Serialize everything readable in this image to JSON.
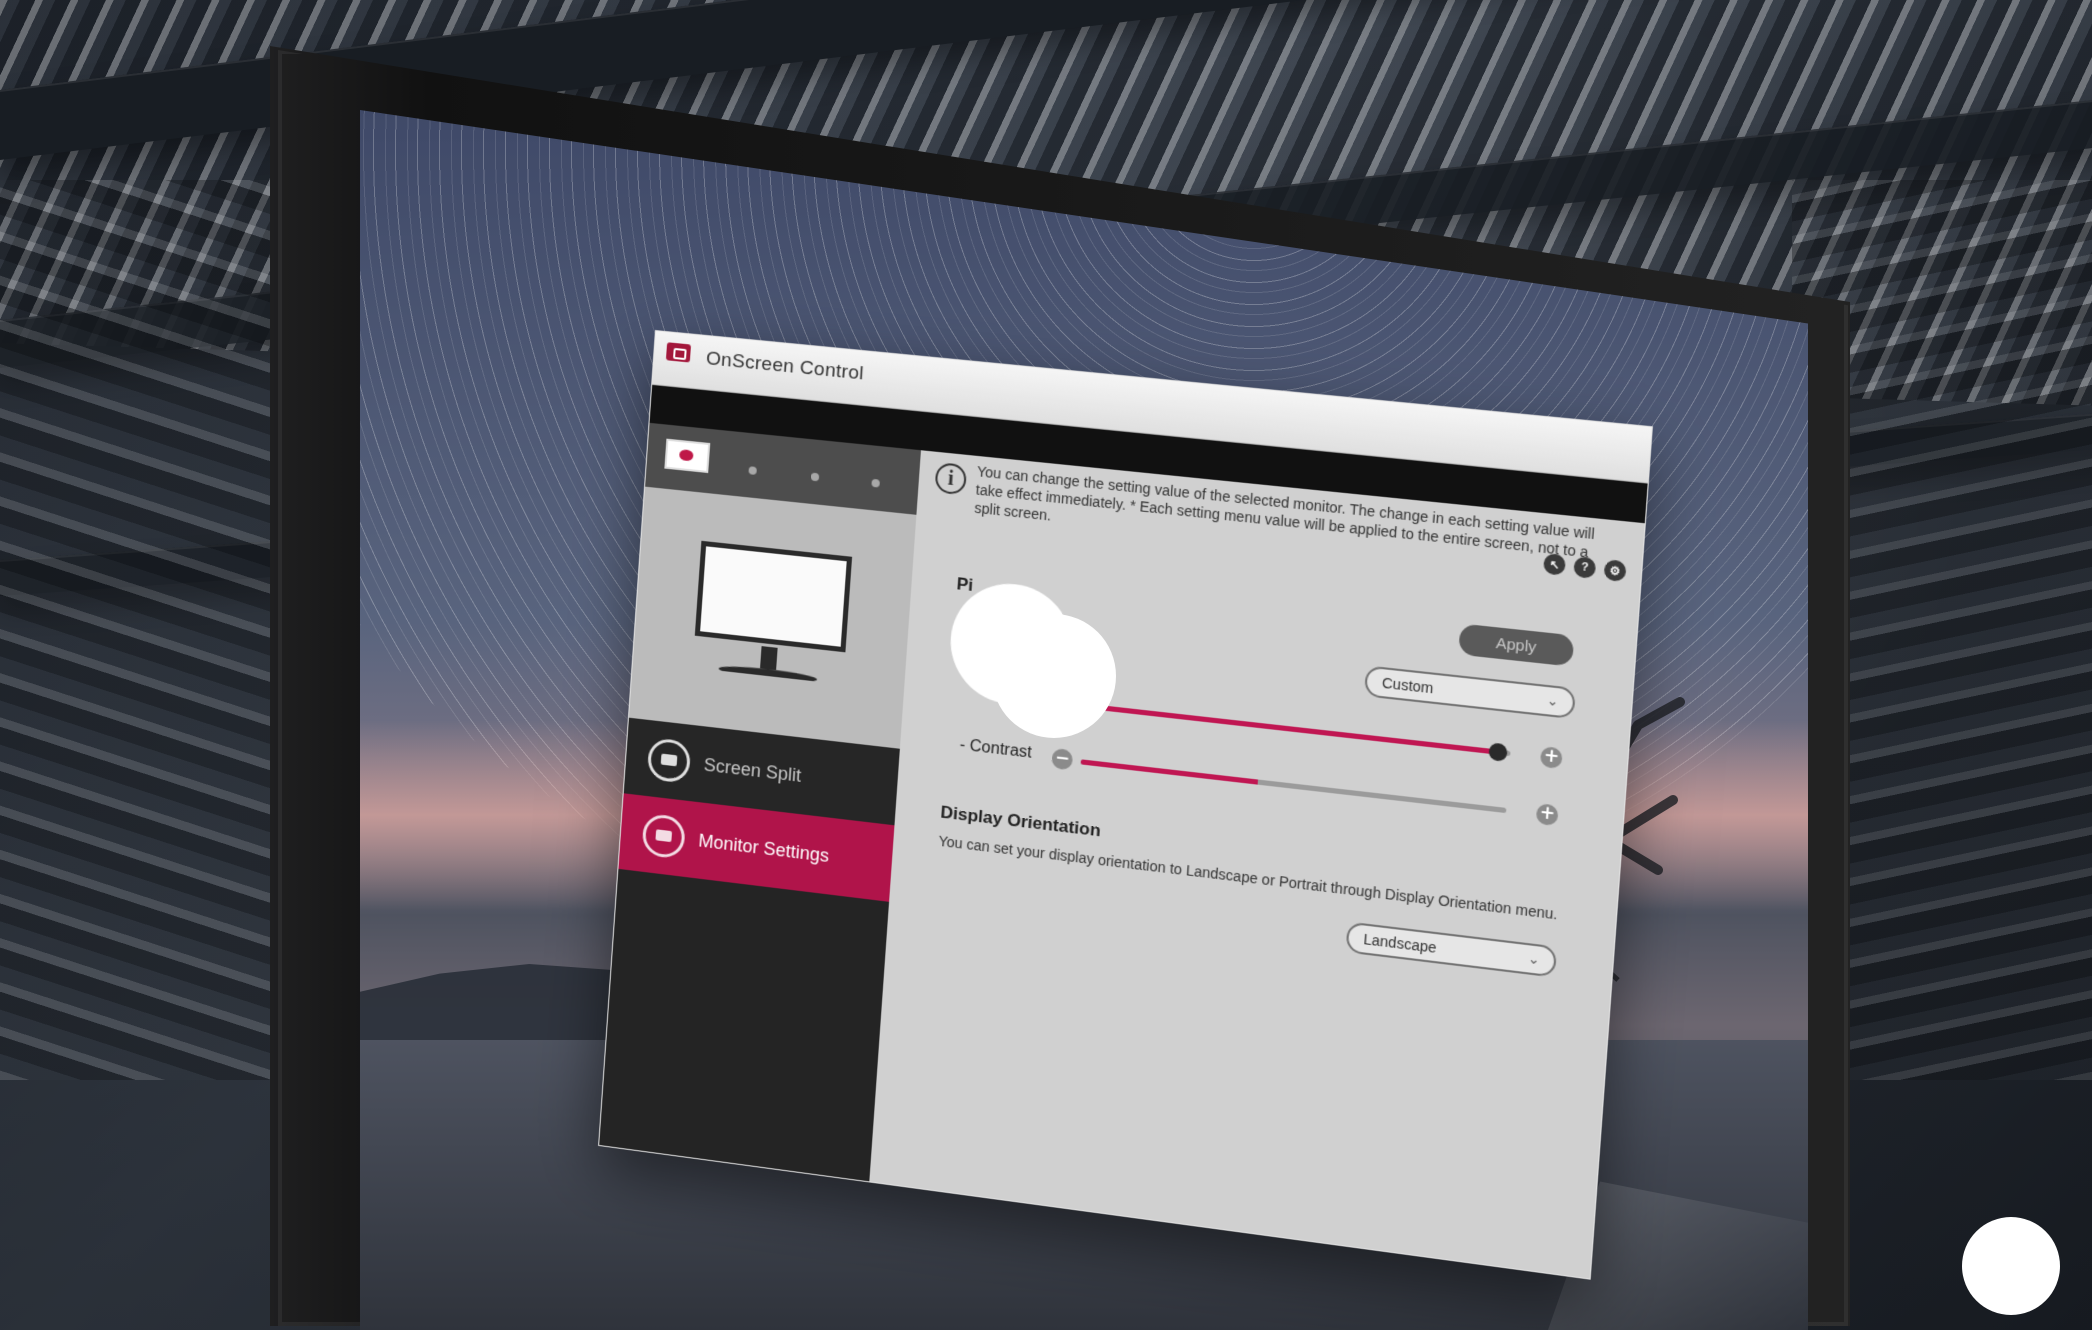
{
  "window": {
    "title": "OnScreen Control"
  },
  "sidebar": {
    "items": [
      {
        "label": "Screen Split",
        "active": false
      },
      {
        "label": "Monitor Settings",
        "active": true
      }
    ]
  },
  "info": {
    "message": "You can change the setting value of the selected monitor. The change in each setting value will take effect immediately. * Each setting menu value will be applied to the entire screen, not to a split screen."
  },
  "picture": {
    "title": "Pi",
    "apply_button": "Apply",
    "mode": "Custom",
    "brightness": {
      "level": 0.97
    },
    "contrast": {
      "label": "- Contrast",
      "level": 0.42
    }
  },
  "orientation": {
    "title": "Display Orientation",
    "selected": "Landscape",
    "description": "You can set your display orientation to Landscape or Portrait through Display Orientation menu."
  },
  "colors": {
    "accent": "#b0144a",
    "sidebar": "#242424",
    "content": "#d0d0d0"
  },
  "icons": {
    "app": "onscreen-control-icon",
    "info": "info-icon",
    "screen_split": "screen-split-icon",
    "monitor_settings": "monitor-settings-icon"
  }
}
